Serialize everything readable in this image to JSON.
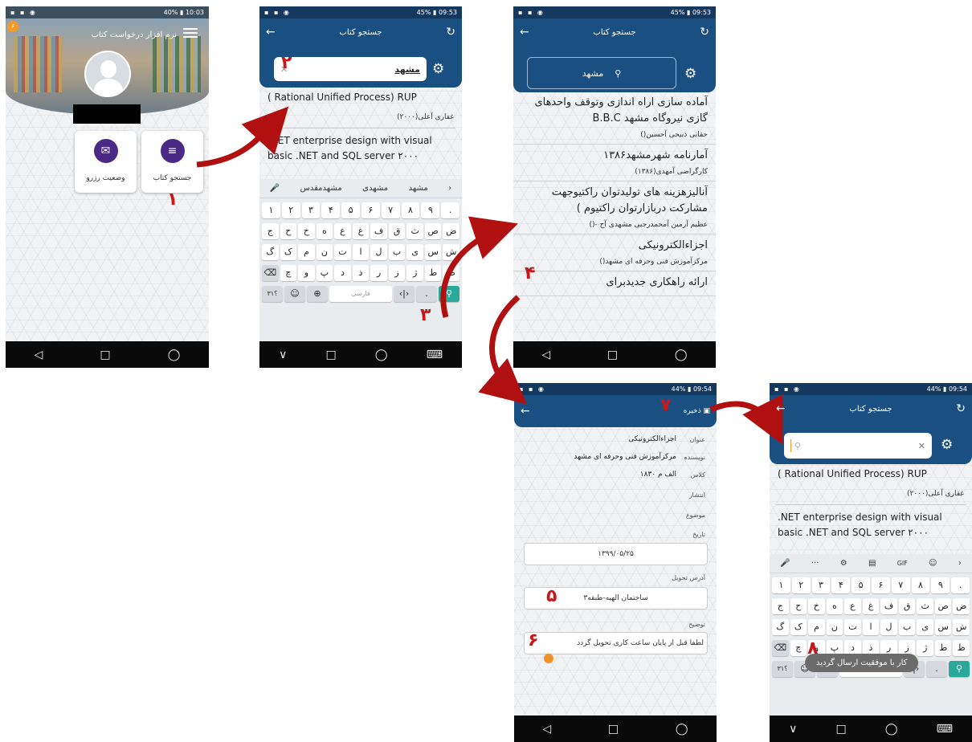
{
  "colors": {
    "accent": "#1a4f82",
    "status_bar": "#15385f",
    "marker": "#c81818",
    "key_action": "#2aa89a"
  },
  "status": {
    "p1": {
      "battery": "40%",
      "time": "10:03"
    },
    "p2": {
      "battery": "45%",
      "time": "09:53"
    },
    "p3": {
      "battery": "45%",
      "time": "09:53"
    },
    "p4": {
      "battery": "44%",
      "time": "09:54"
    },
    "p5": {
      "battery": "44%",
      "time": "09:54"
    }
  },
  "home": {
    "title": "نرم افزار درخواست کتاب",
    "badge": "۶",
    "btn_search": "جستجو کتاب",
    "btn_reserve": "وضعیت رزرو"
  },
  "search_page": {
    "title": "جستجو کتاب",
    "query": "مشهد"
  },
  "results_initial": [
    {
      "title": "( Rational Unified Process) RUP",
      "author": "غفاری آعلی(۲۰۰۰)"
    },
    {
      "title": ".NET enterprise design with visual basic .NET and SQL server ۲۰۰۰",
      "author": ""
    }
  ],
  "keyboard": {
    "suggestions": [
      "مشهد",
      "مشهدی",
      "مشهدمقدس"
    ],
    "row_digits": [
      "۱",
      "۲",
      "۳",
      "۴",
      "۵",
      "۶",
      "۷",
      "۸",
      "۹",
      "."
    ],
    "row1": [
      "ج",
      "ح",
      "خ",
      "ه",
      "ع",
      "غ",
      "ف",
      "ق",
      "ث",
      "ص",
      "ض"
    ],
    "row2": [
      "گ",
      "ک",
      "م",
      "ن",
      "ت",
      "ا",
      "ل",
      "ب",
      "ی",
      "س",
      "ش"
    ],
    "row3": [
      "چ",
      "و",
      "پ",
      "د",
      "ذ",
      "ر",
      "ز",
      "ژ",
      "ط",
      "ظ"
    ],
    "sym": "؟۳۱",
    "lang": "فارسی",
    "toolbar2": [
      "GIF"
    ]
  },
  "results_search": [
    {
      "title": "آماده سازی اراه اندازی وتوقف واحدهای گازی نیروگاه مشهد B.B.C",
      "author": "حقانی ذبیحی آحسین()"
    },
    {
      "title": "آمارنامه شهرمشهد۱۳۸۶",
      "author": "کارگراضی آمهدی(۱۳۸۶)"
    },
    {
      "title": "آنالیزهزینه های تولیدتوان راکتیوجهت مشارکت دربازارتوان راکتیوم )",
      "author": "عظیم آرمین آمحمدرجبی مشهدی آح -()"
    },
    {
      "title": "اجزاءالکترونیکی",
      "author": "مرکزآموزش فنی وحرفه ای مشهد()"
    },
    {
      "title": "ارائه راهکاری جدیدبرای",
      "author": ""
    }
  ],
  "form": {
    "save": "ذخیره",
    "fields": [
      {
        "label": "عنوان",
        "value": "اجزاءالکترونیکی"
      },
      {
        "label": "نویسنده",
        "value": "مرکزآموزش فنی وحرفه ای مشهد"
      },
      {
        "label": "کلاس",
        "value": "الف م ۱۸۳۰"
      },
      {
        "label": "انتشار",
        "value": ""
      },
      {
        "label": "موضوع",
        "value": ""
      },
      {
        "label": "تاریخ",
        "value": ""
      }
    ],
    "date": "۱۳۹۹/۰۵/۲۵",
    "address_label": "آدرس تحویل",
    "address": "ساختمان الهیه-طبقه۳",
    "note_label": "توضیح",
    "note": "لطفا قبل از پایان ساعت کاری تحویل گردد"
  },
  "toast": "کار با موفقیت ارسال گردید",
  "markers": [
    "۱",
    "۲",
    "۳",
    "۴",
    "۵",
    "۶",
    "۷",
    "۸"
  ]
}
